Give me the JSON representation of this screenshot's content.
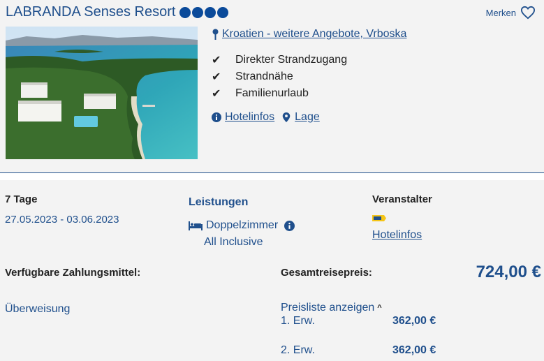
{
  "hotel": {
    "name": "LABRANDA Senses Resort",
    "stars": 4,
    "star_color": "#0a4a9a",
    "merken_label": "Merken",
    "location": "Kroatien - weitere Angebote, Vrboska",
    "features": [
      "Direkter Strandzugang",
      "Strandnähe",
      "Familienurlaub"
    ],
    "links": {
      "hotelinfos": "Hotelinfos",
      "lage": "Lage"
    }
  },
  "offer": {
    "duration": "7 Tage",
    "dates": "27.05.2023 - 03.06.2023",
    "leistungen_label": "Leistungen",
    "room": "Doppelzimmer",
    "board": "All Inclusive",
    "veranstalter_label": "Veranstalter",
    "veranstalter_link": "Hotelinfos",
    "zahlungsmittel_label": "Verfügbare Zahlungsmittel:",
    "zahlungsmittel": "Überweisung",
    "gesamtpreis_label": "Gesamtreisepreis:",
    "gesamtpreis": "724,00 €",
    "preisliste_label": "Preisliste anzeigen",
    "prices": [
      {
        "label": "1. Erw.",
        "value": "362,00 €"
      },
      {
        "label": "2. Erw.",
        "value": "362,00 €"
      }
    ]
  },
  "colors": {
    "accent": "#1f4f8c",
    "background": "#f3f3f3"
  }
}
